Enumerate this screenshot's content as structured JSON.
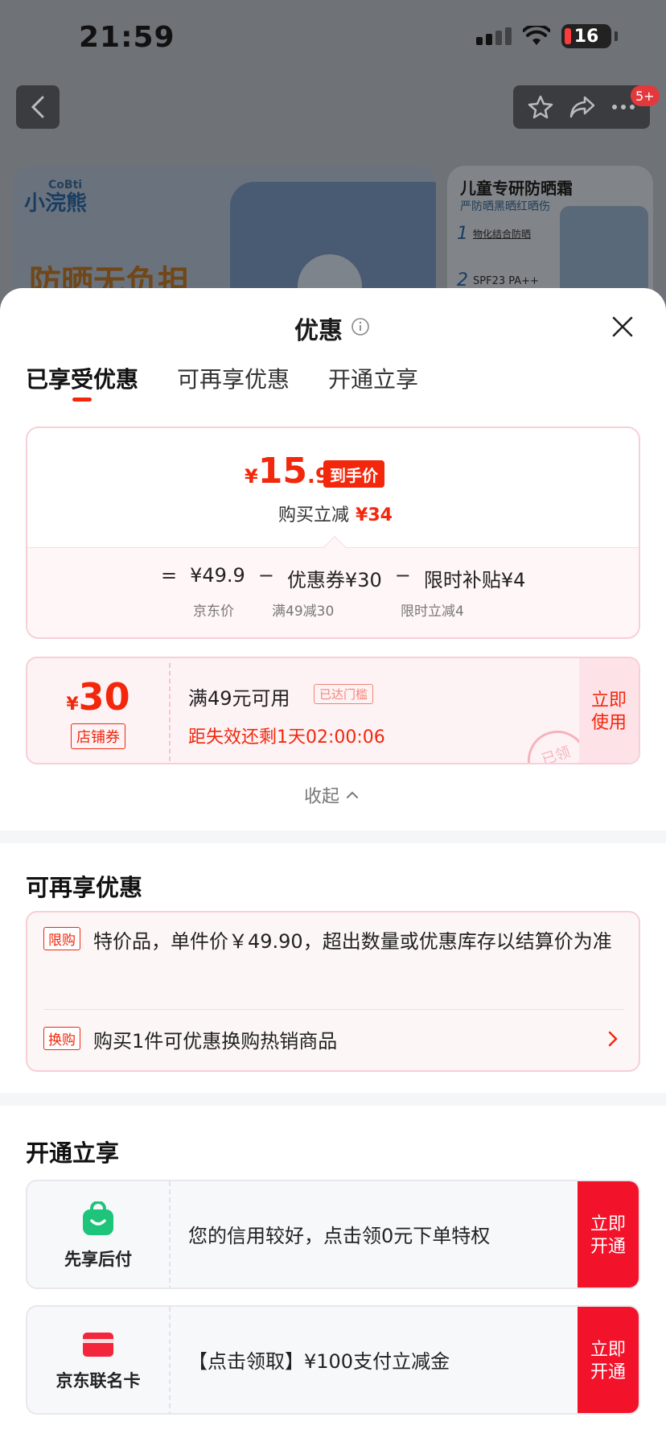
{
  "status_bar": {
    "time": "21:59",
    "battery": "16"
  },
  "nav": {
    "badge": "5+"
  },
  "background_banner": {
    "brand_small": "CoBti",
    "brand_name": "小浣熊",
    "slogan": "防晒无负担",
    "right_title": "儿童专研防晒霜",
    "right_subtitle": "严防晒黑晒红晒伤",
    "right_item1_num": "1",
    "right_item1": "物化结合防晒",
    "right_item2_num": "2",
    "right_item2": "SPF23 PA++"
  },
  "sheet": {
    "title": "优惠",
    "tabs": [
      {
        "label": "已享受优惠",
        "active": true
      },
      {
        "label": "可再享优惠",
        "active": false
      },
      {
        "label": "开通立享",
        "active": false
      }
    ]
  },
  "price": {
    "currency": "¥",
    "integer": "15",
    "decimal": ".9",
    "tag": "到手价",
    "reduce_label": "购买立减",
    "reduce_value": "¥34",
    "formula": {
      "equals": "=",
      "base": "¥49.9",
      "minus1": "−",
      "coupon": "优惠券¥30",
      "minus2": "−",
      "subsidy": "限时补贴¥4"
    },
    "base_label": "京东价",
    "coupon_label": "满49减30",
    "subsidy_label": "限时立减4"
  },
  "coupon": {
    "currency": "¥",
    "amount": "30",
    "type": "店铺券",
    "condition": "满49元可用",
    "badge": "已达门槛",
    "timer": "距失效还剩1天02:00:06",
    "button": "立即\n使用",
    "stamp": "已领"
  },
  "collapse_label": "收起",
  "more_offers": {
    "title": "可再享优惠",
    "items": [
      {
        "tag": "限购",
        "text": "特价品，单件价￥49.90，超出数量或优惠库存以结算价为准"
      },
      {
        "tag": "换购",
        "text": "购买1件可优惠换购热销商品"
      }
    ]
  },
  "open_offers": {
    "title": "开通立享",
    "items": [
      {
        "name": "先享后付",
        "icon": "shopping-bag-icon",
        "text": "您的信用较好，点击领0元下单特权",
        "button": "立即\n开通"
      },
      {
        "name": "京东联名卡",
        "icon": "credit-card-icon",
        "text": "【点击领取】¥100支付立减金",
        "button": "立即\n开通"
      }
    ]
  },
  "colors": {
    "accent": "#f2270c",
    "button_red": "#f2132b",
    "green": "#1ec47a"
  }
}
